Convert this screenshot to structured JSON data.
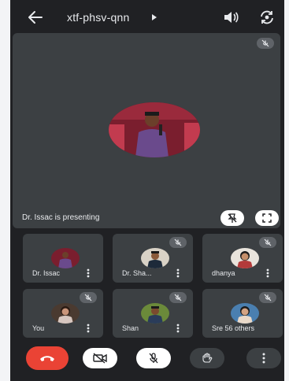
{
  "topbar": {
    "meeting_code": "xtf-phsv-qnn"
  },
  "main": {
    "presenting_label": "Dr. Issac is presenting"
  },
  "tiles": [
    {
      "label": "Dr. Issac"
    },
    {
      "label": "Dr. Sha..."
    },
    {
      "label": "dhanya"
    },
    {
      "label": "You"
    },
    {
      "label": "Shan"
    },
    {
      "label": "Sre 56 others"
    }
  ],
  "colors": {
    "background": "#202124",
    "tile": "#3c4043",
    "end_call": "#ea4335",
    "text": "#e8eaed"
  },
  "icons": {
    "back": "arrow-left-icon",
    "speaker": "speaker-icon",
    "flip_camera": "flip-camera-icon",
    "mic_off": "mic-off-icon",
    "pin": "pin-off-icon",
    "fullscreen": "fullscreen-icon",
    "end_call": "phone-end-icon",
    "camera_off": "camera-off-icon",
    "raise_hand": "hand-icon",
    "more": "more-vert-icon"
  }
}
